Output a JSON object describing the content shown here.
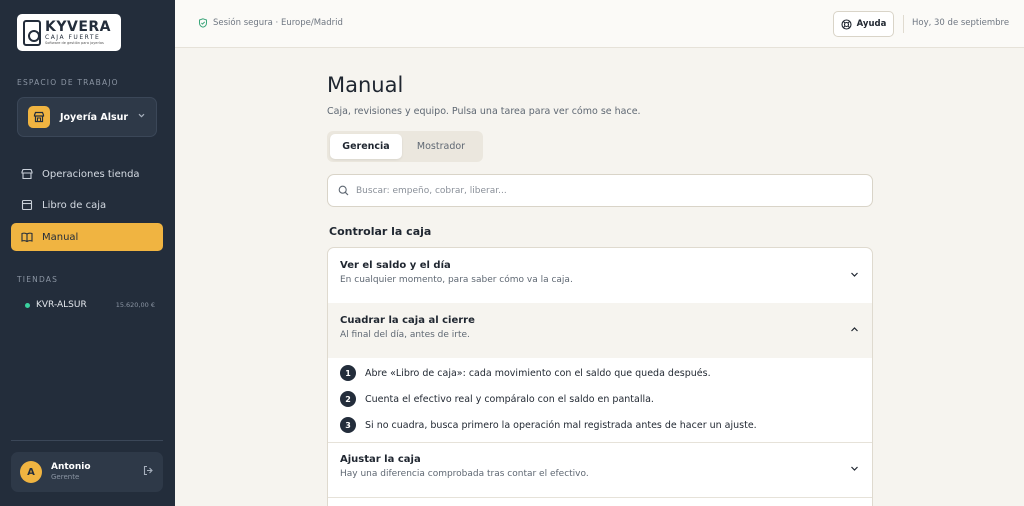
{
  "brand": {
    "name": "KYVERA",
    "sub": "CAJA FUERTE",
    "tagline": "Software de gestión para joyerías"
  },
  "sidebar": {
    "workspace_label": "ESPACIO DE TRABAJO",
    "workspace_name": "Joyería Alsur",
    "nav": [
      {
        "label": "Operaciones tienda",
        "icon": "store-icon"
      },
      {
        "label": "Libro de caja",
        "icon": "ledger-icon"
      },
      {
        "label": "Manual",
        "icon": "book-icon",
        "active": true
      }
    ],
    "stores_label": "TIENDAS",
    "stores": [
      {
        "name": "KVR-ALSUR",
        "amount": "15.620,00 €",
        "status_color": "#3ad29f"
      }
    ],
    "user": {
      "initial": "A",
      "name": "Antonio",
      "role": "Gerente"
    }
  },
  "topbar": {
    "secure": "Sesión segura · Europe/Madrid",
    "help_label": "Ayuda",
    "date": "Hoy, 30 de septiembre"
  },
  "main": {
    "title": "Manual",
    "subtitle": "Caja, revisiones y equipo. Pulsa una tarea para ver cómo se hace.",
    "tabs": [
      {
        "label": "Gerencia",
        "active": true
      },
      {
        "label": "Mostrador",
        "active": false
      }
    ],
    "search_placeholder": "Buscar: empeño, cobrar, liberar...",
    "section_title": "Controlar la caja",
    "tasks": [
      {
        "title": "Ver el saldo y el día",
        "desc": "En cualquier momento, para saber cómo va la caja.",
        "open": false
      },
      {
        "title": "Cuadrar la caja al cierre",
        "desc": "Al final del día, antes de irte.",
        "open": true,
        "steps": [
          {
            "n": "1",
            "text": "Abre «Libro de caja»: cada movimiento con el saldo que queda después."
          },
          {
            "n": "2",
            "text": "Cuenta el efectivo real y compáralo con el saldo en pantalla."
          },
          {
            "n": "3",
            "text": "Si no cuadra, busca primero la operación mal registrada antes de hacer un ajuste."
          }
        ]
      },
      {
        "title": "Ajustar la caja",
        "desc": "Hay una diferencia comprobada tras contar el efectivo.",
        "open": false
      }
    ]
  },
  "colors": {
    "accent": "#f0b441",
    "sidebar_bg": "#232d3b",
    "page_bg": "#f6f4ef"
  }
}
